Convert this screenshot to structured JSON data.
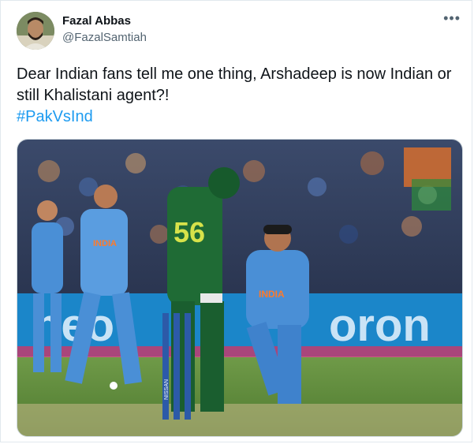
{
  "tweet": {
    "author_name": "Fazal Abbas",
    "author_handle": "@FazalSamtiah",
    "more_icon": "more-horizontal-icon",
    "text": "Dear Indian fans tell me one thing, Arshadeep is now Indian or still Khalistani agent?!",
    "hashtag": "#PakVsInd"
  },
  "media": {
    "jersey_text_india": "INDIA",
    "jersey_text_pakistan": "56",
    "board_text_left": "neo",
    "board_text_right": "oron",
    "stump_text": "NISSAN"
  },
  "colors": {
    "link": "#1d9bf0",
    "india_blue": "#4a8fd6",
    "pakistan_green": "#1f6b35",
    "pitch_green": "#5f8f3e"
  }
}
